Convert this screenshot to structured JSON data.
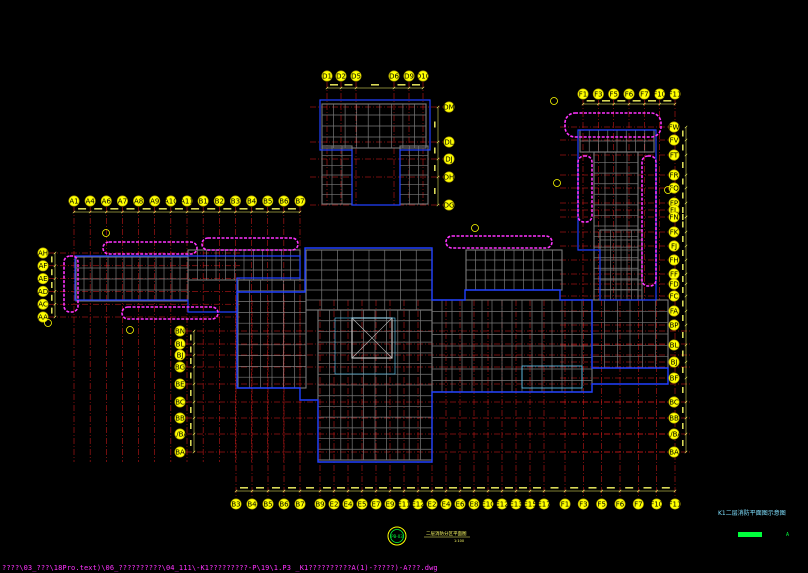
{
  "drawing": {
    "path_text": "????\\03_???\\18Pro.text)\\06_??????????\\04_111\\-K1?????????-P\\19\\1.P3 _K1??????????A(1)-?????)-A???.dwg",
    "title_block_text": "K1二层消防平面图示意图",
    "sheet_label": "PB-03",
    "sub_title": "二层消防分区平面图",
    "sub_scale": "1:100",
    "legend_mark": "A"
  },
  "colors": {
    "wall": "#7a7a7a",
    "axis_line": "#ff2020",
    "fire_zone": "#ff33ff",
    "boundary": "#2040ff",
    "bubble": "#ffff00",
    "dim": "#ffff66",
    "cyan": "#5fd0ff",
    "green": "#00ff3c"
  },
  "grid": {
    "top_left_labels": [
      "A1",
      "A4",
      "A6",
      "A7",
      "A8",
      "A9",
      "A10",
      "A11",
      "B1",
      "B2",
      "B3",
      "B4",
      "B5",
      "B6",
      "B7"
    ],
    "top_mid_labels": [
      "D1",
      "D2",
      "D5",
      "D6",
      "D9",
      "D10"
    ],
    "top_right_labels": [
      "F1",
      "F3",
      "F5",
      "F6",
      "F7",
      "F10",
      "F11"
    ],
    "bottom_labels": [
      "B3",
      "B4",
      "B5",
      "B6",
      "B7",
      "B9",
      "E2",
      "E4",
      "E5",
      "E7",
      "E9",
      "E11",
      "E12",
      "E2",
      "E4",
      "E6",
      "E8",
      "E10",
      "E12",
      "E13",
      "E15",
      "E17",
      "F1",
      "F3",
      "F5",
      "F6",
      "F7",
      "F10",
      "F11"
    ],
    "left_upper_labels": [
      "AH",
      "AF",
      "AE",
      "AD",
      "AC",
      "AA"
    ],
    "left_lower_labels": [
      "BN",
      "BL",
      "BJ",
      "BG",
      "BE",
      "BC",
      "BB",
      "1/BA",
      "BA"
    ],
    "mid_right_labels": [
      "DM",
      "DL",
      "DJ",
      "DH",
      "DG"
    ],
    "right_labels": [
      "FW",
      "FV",
      "FT",
      "FR",
      "FQ",
      "FP",
      "FL",
      "FN",
      "FK",
      "FJ",
      "FH",
      "FF",
      "FD",
      "FC",
      "FA",
      "BP",
      "BL",
      "BJ",
      "BF",
      "BC",
      "BB",
      "1/BA",
      "BA"
    ]
  }
}
